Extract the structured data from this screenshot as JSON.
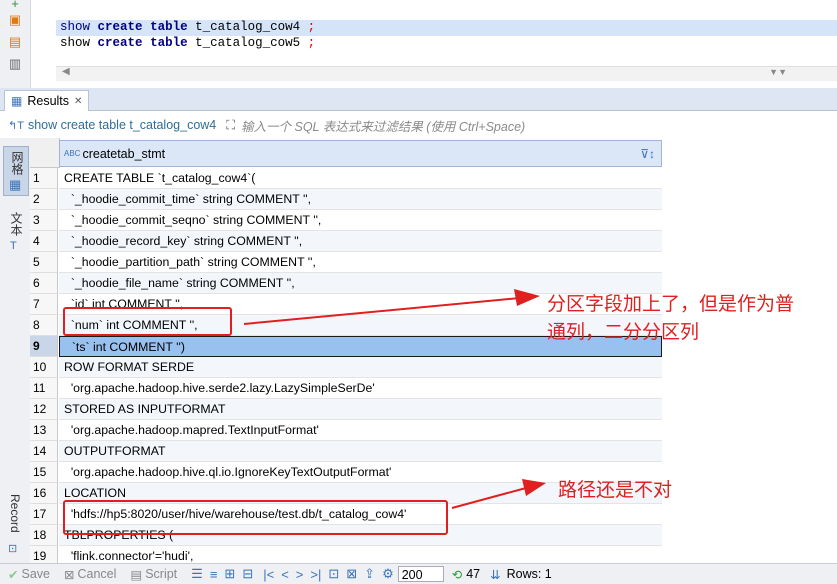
{
  "editor": {
    "lines": [
      {
        "kw1": "show",
        "kw2": "create",
        "kw3": "table",
        "ident": " t_catalog_cow4 ",
        "semi": ";"
      },
      {
        "kw1": "show",
        "kw2": "create",
        "kw3": "table",
        "ident": " t_catalog_cow5 ",
        "semi": ";"
      }
    ]
  },
  "results_tab": {
    "label": "Results",
    "close": "✕"
  },
  "filter_bar": {
    "query_label": "show create table t_catalog_cow4",
    "placeholder": "输入一个 SQL 表达式来过滤结果 (使用 Ctrl+Space)"
  },
  "side_panel": {
    "grid_label": "网格",
    "text_label": "文本",
    "record_label": "Record"
  },
  "grid": {
    "column_header": "createtab_stmt",
    "column_type_badge": "ABC",
    "rows": [
      {
        "n": "1",
        "v": "CREATE TABLE `t_catalog_cow4`("
      },
      {
        "n": "2",
        "v": "  `_hoodie_commit_time` string COMMENT '',"
      },
      {
        "n": "3",
        "v": "  `_hoodie_commit_seqno` string COMMENT '',"
      },
      {
        "n": "4",
        "v": "  `_hoodie_record_key` string COMMENT '',"
      },
      {
        "n": "5",
        "v": "  `_hoodie_partition_path` string COMMENT '',"
      },
      {
        "n": "6",
        "v": "  `_hoodie_file_name` string COMMENT '',"
      },
      {
        "n": "7",
        "v": "  `id` int COMMENT '',"
      },
      {
        "n": "8",
        "v": "  `num` int COMMENT '',"
      },
      {
        "n": "9",
        "v": "  `ts` int COMMENT '')"
      },
      {
        "n": "10",
        "v": "ROW FORMAT SERDE"
      },
      {
        "n": "11",
        "v": "  'org.apache.hadoop.hive.serde2.lazy.LazySimpleSerDe'"
      },
      {
        "n": "12",
        "v": "STORED AS INPUTFORMAT"
      },
      {
        "n": "13",
        "v": "  'org.apache.hadoop.mapred.TextInputFormat'"
      },
      {
        "n": "14",
        "v": "OUTPUTFORMAT"
      },
      {
        "n": "15",
        "v": "  'org.apache.hadoop.hive.ql.io.IgnoreKeyTextOutputFormat'"
      },
      {
        "n": "16",
        "v": "LOCATION"
      },
      {
        "n": "17",
        "v": "  'hdfs://hp5:8020/user/hive/warehouse/test.db/t_catalog_cow4'"
      },
      {
        "n": "18",
        "v": "TBLPROPERTIES ("
      },
      {
        "n": "19",
        "v": "  'flink.connector'='hudi',"
      }
    ],
    "selected_row": "9"
  },
  "annotations": {
    "note1_line1": "分区字段加上了，但是作为普",
    "note1_line2": "通列，二分分区列",
    "note2": "路径还是不对"
  },
  "footer": {
    "save": "Save",
    "cancel": "Cancel",
    "script": "Script",
    "fetch_size": "200",
    "count": "47",
    "rows_label": "Rows: 1"
  },
  "colors": {
    "annotation": "#e02020",
    "selection": "#99c1ef",
    "accent": "#3b73b8"
  }
}
